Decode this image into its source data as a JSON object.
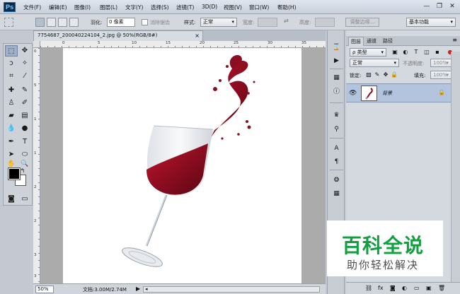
{
  "app": {
    "logo": "Ps"
  },
  "menu": [
    "文件(F)",
    "编辑(E)",
    "图像(I)",
    "图层(L)",
    "文字(Y)",
    "选择(S)",
    "滤镜(T)",
    "3D(D)",
    "视图(V)",
    "窗口(W)",
    "帮助(H)"
  ],
  "window_controls": {
    "minimize": "—",
    "restore": "❐",
    "close": "✕"
  },
  "options": {
    "feather_label": "羽化:",
    "feather_value": "0 像素",
    "antialias_label": "消除锯齿",
    "style_label": "样式:",
    "style_value": "正常",
    "width_label": "宽度:",
    "height_label": "高度:",
    "refine_edge": "调整边缘...",
    "workspace": "基本功能"
  },
  "document": {
    "tab_title": "7754687_200040224104_2.jpg @ 50%(RGB/8#)",
    "close_glyph": "×",
    "ruler_top": [
      "0",
      "5",
      "10",
      "15",
      "20",
      "25",
      "30",
      "35"
    ],
    "ruler_left": [
      "0",
      "5",
      "1",
      "1",
      "2",
      "2",
      "3",
      "3"
    ]
  },
  "status": {
    "zoom": "50%",
    "doc_info": "文档:3.00M/2.74M",
    "arrow": "▶"
  },
  "layers_panel": {
    "tabs": [
      "图层",
      "通道",
      "路径"
    ],
    "kind_filter": "ρ 类型",
    "blend_mode": "正常",
    "opacity_label": "不透明度:",
    "opacity_value": "100%",
    "lock_label": "锁定:",
    "fill_label": "填充:",
    "fill_value": "100%",
    "layer_name": "背景",
    "panel_menu": "≡"
  },
  "icons": {
    "eye": "👁",
    "lock": "🔒"
  },
  "watermark": {
    "title": "百科全说",
    "subtitle": "助你轻松解决"
  },
  "colors": {
    "accent_green": "#10a040",
    "selection_blue": "#b3c4de",
    "wine": "#8a0f22"
  }
}
